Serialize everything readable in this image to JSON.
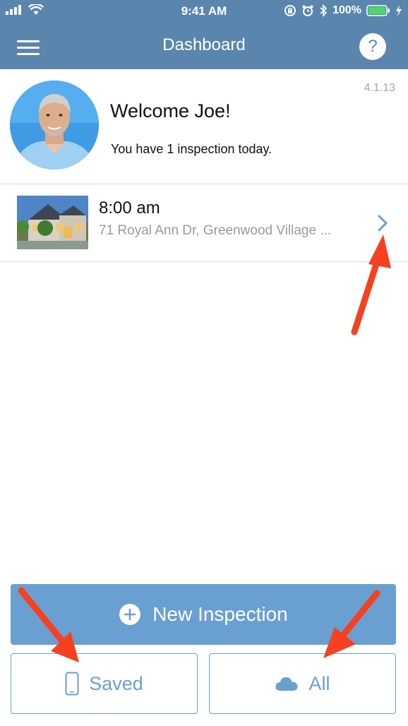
{
  "status_bar": {
    "time": "9:41 AM",
    "battery": "100%"
  },
  "nav": {
    "title": "Dashboard",
    "help_label": "?"
  },
  "welcome": {
    "version": "4.1.13",
    "heading": "Welcome Joe!",
    "subtext": "You have 1 inspection today."
  },
  "inspections": [
    {
      "time": "8:00 am",
      "address": "71 Royal Ann Dr, Greenwood Village ..."
    }
  ],
  "actions": {
    "new_inspection": "New Inspection",
    "saved": "Saved",
    "all": "All"
  },
  "colors": {
    "nav_bar": "#5a86ad",
    "button": "#6a9fd1",
    "annotation_arrow": "#f5411f"
  },
  "icons": {
    "menu": "hamburger-icon",
    "help": "help-icon",
    "row": "chevron-right-icon",
    "new": "plus-circle-icon",
    "saved": "phone-icon",
    "all": "cloud-icon"
  }
}
